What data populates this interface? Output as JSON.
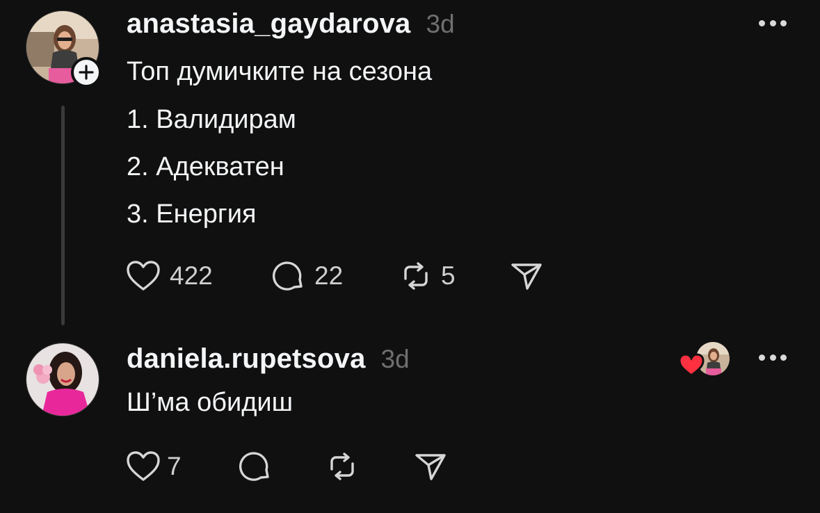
{
  "posts": [
    {
      "username": "anastasia_gaydarova",
      "time": "3d",
      "lines": [
        "Топ думичките на сезона",
        "1. Валидирам",
        "2. Адекватен",
        "3. Енергия"
      ],
      "likes": "422",
      "replies": "22",
      "reposts": "5",
      "avatar_icon": "user-avatar",
      "follow_icon": "plus-icon"
    },
    {
      "username": "daniela.rupetsova",
      "time": "3d",
      "lines": [
        "Ш’ма обидиш"
      ],
      "likes": "7",
      "liked_by_author": true,
      "avatar_icon": "user-avatar"
    }
  ],
  "icons": {
    "like": "heart-icon",
    "reply": "comment-icon",
    "repost": "repost-icon",
    "share": "send-icon",
    "more": "more-icon"
  },
  "colors": {
    "background": "#101010",
    "text": "#f3f5f7",
    "muted": "#6f6f6f",
    "heart_red": "#ff3040"
  }
}
